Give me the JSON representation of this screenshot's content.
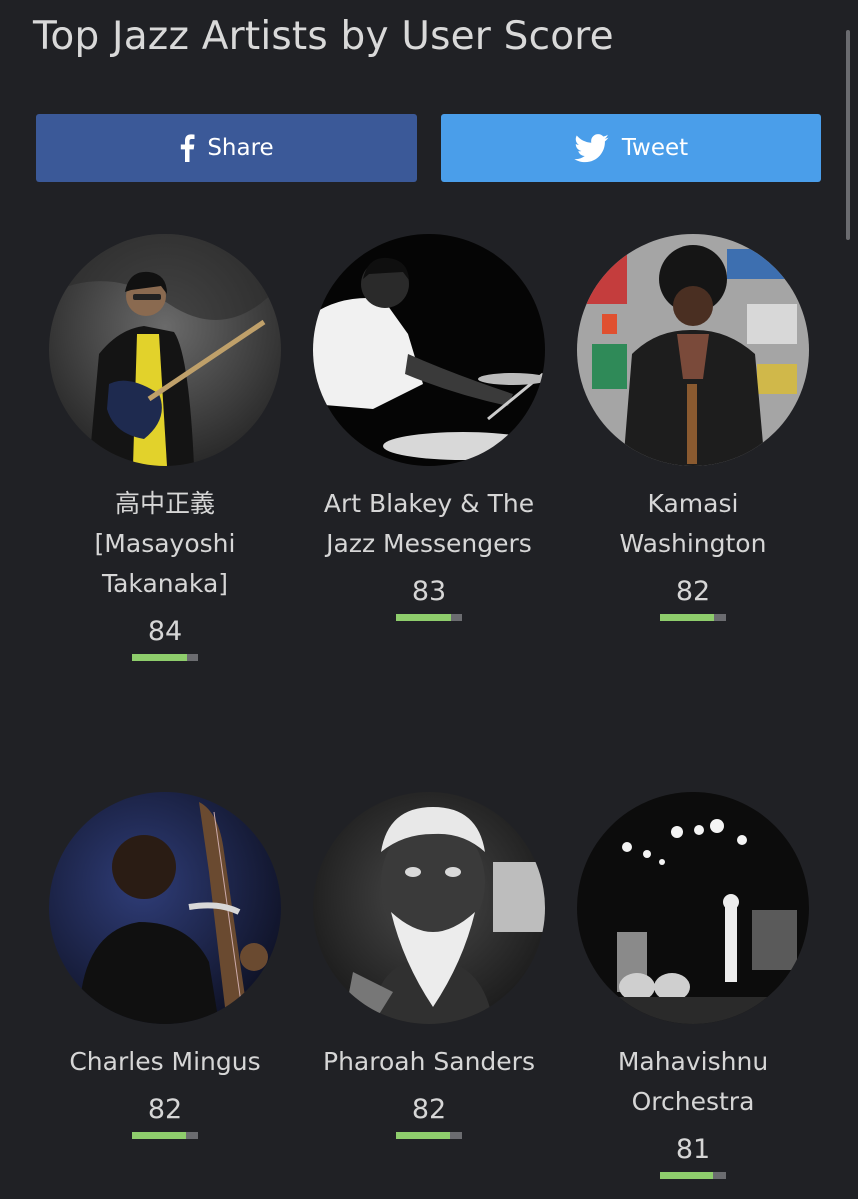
{
  "page_title": "Top Jazz Artists by User Score",
  "buttons": {
    "share_label": "Share",
    "tweet_label": "Tweet",
    "share_color": "#3b5998",
    "tweet_color": "#4a9eea"
  },
  "colors": {
    "background": "#202125",
    "score_bar_fill": "#8ecd6c",
    "score_bar_track": "#6b6c70"
  },
  "artists": [
    {
      "name_line1": "高中正義",
      "name_line2": "[Masayoshi",
      "name_line3": "Takanaka]",
      "score": "84",
      "score_fraction": 0.84,
      "photo": "guitarist-photo"
    },
    {
      "name_line1": "Art Blakey & The",
      "name_line2": "Jazz Messengers",
      "score": "83",
      "score_fraction": 0.83,
      "photo": "drummer-photo"
    },
    {
      "name_line1": "Kamasi",
      "name_line2": "Washington",
      "score": "82",
      "score_fraction": 0.82,
      "photo": "saxophonist-photo"
    },
    {
      "name_line1": "Charles Mingus",
      "score": "82",
      "score_fraction": 0.82,
      "photo": "bassist-photo"
    },
    {
      "name_line1": "Pharoah Sanders",
      "score": "82",
      "score_fraction": 0.82,
      "photo": "portrait-photo"
    },
    {
      "name_line1": "Mahavishnu",
      "name_line2": "Orchestra",
      "score": "81",
      "score_fraction": 0.81,
      "photo": "band-stage-photo"
    }
  ]
}
